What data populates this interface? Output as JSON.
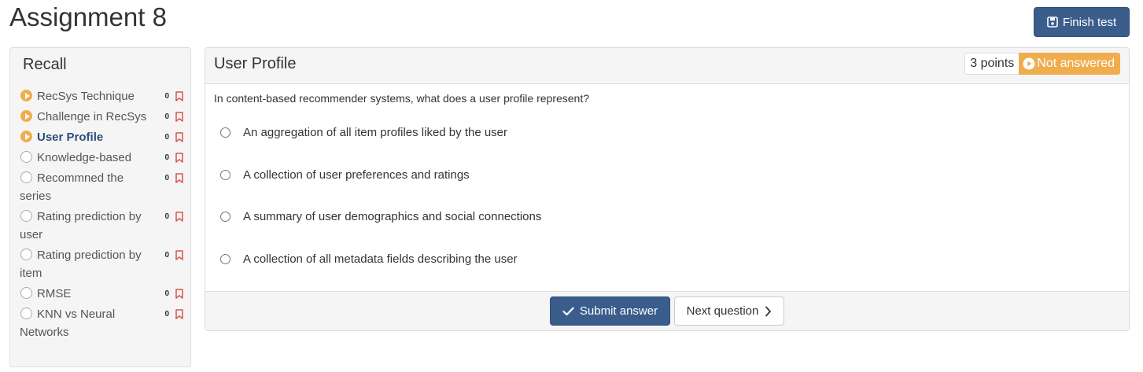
{
  "page": {
    "title": "Assignment 8"
  },
  "toolbar": {
    "finish_label": "Finish test"
  },
  "sidebar": {
    "title": "Recall",
    "items": [
      {
        "label": "RecSys Technique",
        "count": "0",
        "status": "played",
        "active": false
      },
      {
        "label": "Challenge in RecSys",
        "count": "0",
        "status": "played",
        "active": false
      },
      {
        "label": "User Profile",
        "count": "0",
        "status": "played",
        "active": true
      },
      {
        "label": "Knowledge-based",
        "count": "0",
        "status": "empty",
        "active": false
      },
      {
        "label": "Recommned the series",
        "count": "0",
        "status": "empty",
        "active": false
      },
      {
        "label": "Rating prediction by user",
        "count": "0",
        "status": "empty",
        "active": false
      },
      {
        "label": "Rating prediction by item",
        "count": "0",
        "status": "empty",
        "active": false
      },
      {
        "label": "RMSE",
        "count": "0",
        "status": "empty",
        "active": false
      },
      {
        "label": "KNN vs Neural Networks",
        "count": "0",
        "status": "empty",
        "active": false
      }
    ]
  },
  "question": {
    "title": "User Profile",
    "points": "3 points",
    "status": "Not answered",
    "text": "In content-based recommender systems, what does a user profile represent?",
    "options": [
      "An aggregation of all item profiles liked by the user",
      "A collection of user preferences and ratings",
      "A summary of user demographics and social connections",
      "A collection of all metadata fields describing the user"
    ]
  },
  "footer": {
    "submit_label": "Submit answer",
    "next_label": "Next question"
  },
  "colors": {
    "primary": "#3a5d8c",
    "warning": "#f0ad4e",
    "bookmark": "#d9534f",
    "active_text": "#2a4f7d"
  },
  "icons": {
    "finish": "floppy-disk-icon",
    "submit": "check-icon",
    "next": "chevron-right-icon",
    "status": "play-circle-icon",
    "bookmark": "bookmark-icon"
  }
}
